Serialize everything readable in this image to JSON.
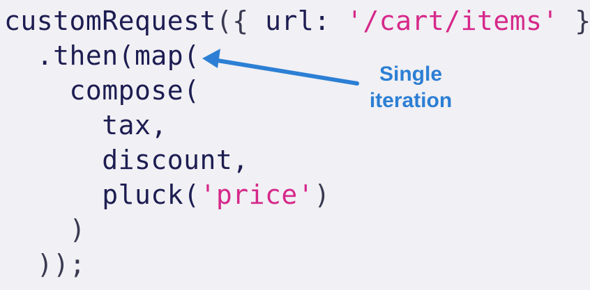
{
  "code": {
    "lines": [
      {
        "tokens": [
          {
            "text": "customRequest",
            "kind": "fn"
          },
          {
            "text": "({ ",
            "kind": "punct"
          },
          {
            "text": "url: ",
            "kind": "id"
          },
          {
            "text": "'/cart/items'",
            "kind": "str"
          },
          {
            "text": " })",
            "kind": "punct"
          }
        ]
      },
      {
        "tokens": [
          {
            "text": "  .then(",
            "kind": "fn"
          },
          {
            "text": "map(",
            "kind": "fn"
          }
        ]
      },
      {
        "tokens": [
          {
            "text": "    compose(",
            "kind": "fn"
          }
        ]
      },
      {
        "tokens": [
          {
            "text": "      tax,",
            "kind": "id"
          }
        ]
      },
      {
        "tokens": [
          {
            "text": "      discount,",
            "kind": "id"
          }
        ]
      },
      {
        "tokens": [
          {
            "text": "      pluck(",
            "kind": "fn"
          },
          {
            "text": "'price'",
            "kind": "str"
          },
          {
            "text": ")",
            "kind": "punct"
          }
        ]
      },
      {
        "tokens": [
          {
            "text": "    )",
            "kind": "punct"
          }
        ]
      },
      {
        "tokens": [
          {
            "text": "  ));",
            "kind": "punct"
          }
        ]
      }
    ]
  },
  "annotation": {
    "line1": "Single",
    "line2": "iteration",
    "color": "#2c7fd4"
  },
  "colors": {
    "background": "#f1f0f4",
    "code": "#1d1d52",
    "string": "#d6288a"
  }
}
